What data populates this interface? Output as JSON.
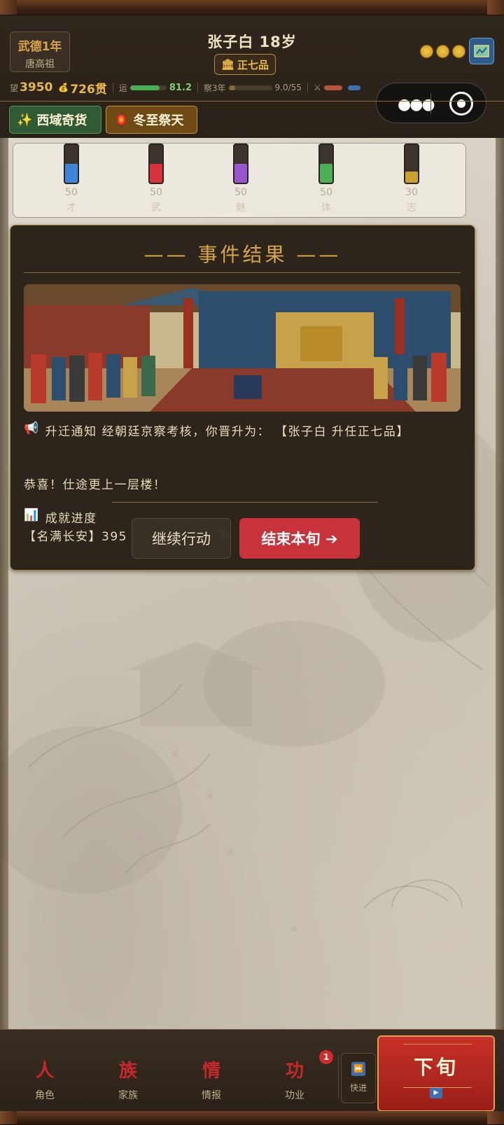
{
  "era": {
    "year": "武德1年",
    "emperor": "唐高祖"
  },
  "character": {
    "name_age": "张子白  18岁",
    "rank": "正七品"
  },
  "stats": {
    "prestige_icon": "望",
    "prestige": "3950",
    "money": "726贯",
    "luck_label": "运",
    "luck": "81.2",
    "luck_fraction": 0.81,
    "exam_label": "察3年",
    "exam_progress": "9.0/55",
    "exam_fraction": 0.16
  },
  "tags": [
    {
      "icon": "sparkle-icon",
      "label": "西域奇货"
    },
    {
      "icon": "lantern-icon",
      "label": "冬至祭天"
    }
  ],
  "attributes": [
    {
      "name": "才",
      "value": "50",
      "color": "#3f86d8",
      "fraction": 0.5
    },
    {
      "name": "武",
      "value": "50",
      "color": "#d8333a",
      "fraction": 0.5
    },
    {
      "name": "魅",
      "value": "50",
      "color": "#9a55d0",
      "fraction": 0.5
    },
    {
      "name": "体",
      "value": "50",
      "color": "#4caf55",
      "fraction": 0.5
    },
    {
      "name": "志",
      "value": "30",
      "color": "#c9a22e",
      "fraction": 0.3
    }
  ],
  "event": {
    "title": "—— 事件结果 ——",
    "notice_icon": "📢",
    "notice": "升迁通知  经朝廷京察考核，你晋升为：  【张子白 升任正七品】",
    "congrats": "恭喜！仕途更上一层楼！",
    "progress_icon": "📊",
    "progress_title": "成就进度",
    "progress_text": "【名满长安】395",
    "progress_tail": "%",
    "continue_label": "继续行动",
    "end_label": "结束本旬 ➔"
  },
  "nav": {
    "items": [
      {
        "glyph": "人",
        "label": "角色"
      },
      {
        "glyph": "族",
        "label": "家族"
      },
      {
        "glyph": "情",
        "label": "情报"
      },
      {
        "glyph": "功",
        "label": "功业"
      }
    ],
    "badge": "1",
    "fast_label": "快进",
    "next_label": "下旬"
  }
}
